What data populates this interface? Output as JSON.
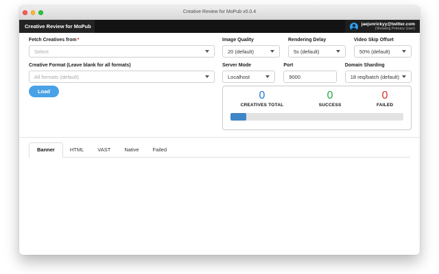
{
  "window": {
    "titlebar": {
      "title": "Creative Review for MoPub v0.0.4"
    },
    "header": {
      "brand": "Creative Review for MoPub",
      "user": {
        "email": "jaejunrickyy@twitter.com",
        "subtitle": "(Showing Primary User)",
        "avatar_icon": "twitter-user-avatar"
      }
    }
  },
  "form": {
    "fetch_from": {
      "label": "Fetch Creatives from",
      "required_marker": "*",
      "value": "Select",
      "is_placeholder": true
    },
    "creative_format": {
      "label": "Creative Format (Leave blank for all formats)",
      "value": "All formats (default)",
      "is_placeholder": true
    },
    "image_quality": {
      "label": "Image Quality",
      "value": "20 (default)"
    },
    "rendering_delay": {
      "label": "Rendering Delay",
      "value": "5s (default)"
    },
    "video_skip_offset": {
      "label": "Video Skip Offset",
      "value": "50% (default)"
    },
    "server_mode": {
      "label": "Server Mode",
      "value": "Localhost"
    },
    "port": {
      "label": "Port",
      "value": "9000"
    },
    "domain_sharding": {
      "label": "Domain Sharding",
      "value": "18 req/batch (default)"
    },
    "load_button_label": "Load"
  },
  "stats": {
    "items": [
      {
        "value": "0",
        "label": "CREATIVES TOTAL",
        "color": "#1d78d2"
      },
      {
        "value": "0",
        "label": "SUCCESS",
        "color": "#28a745"
      },
      {
        "value": "0",
        "label": "FAILED",
        "color": "#d0342c"
      }
    ],
    "progress_percent": 9,
    "progress_fill_color": "#3e86c7",
    "progress_track_color": "#e3e3e3"
  },
  "tabs": [
    {
      "label": "Banner",
      "active": true
    },
    {
      "label": "HTML",
      "active": false
    },
    {
      "label": "VAST",
      "active": false
    },
    {
      "label": "Native",
      "active": false
    },
    {
      "label": "Failed",
      "active": false
    }
  ],
  "colors": {
    "header_background": "#131313",
    "accent_button": "#49a2e6",
    "avatar_blue": "#2d9ded",
    "required_red": "#e02020"
  }
}
